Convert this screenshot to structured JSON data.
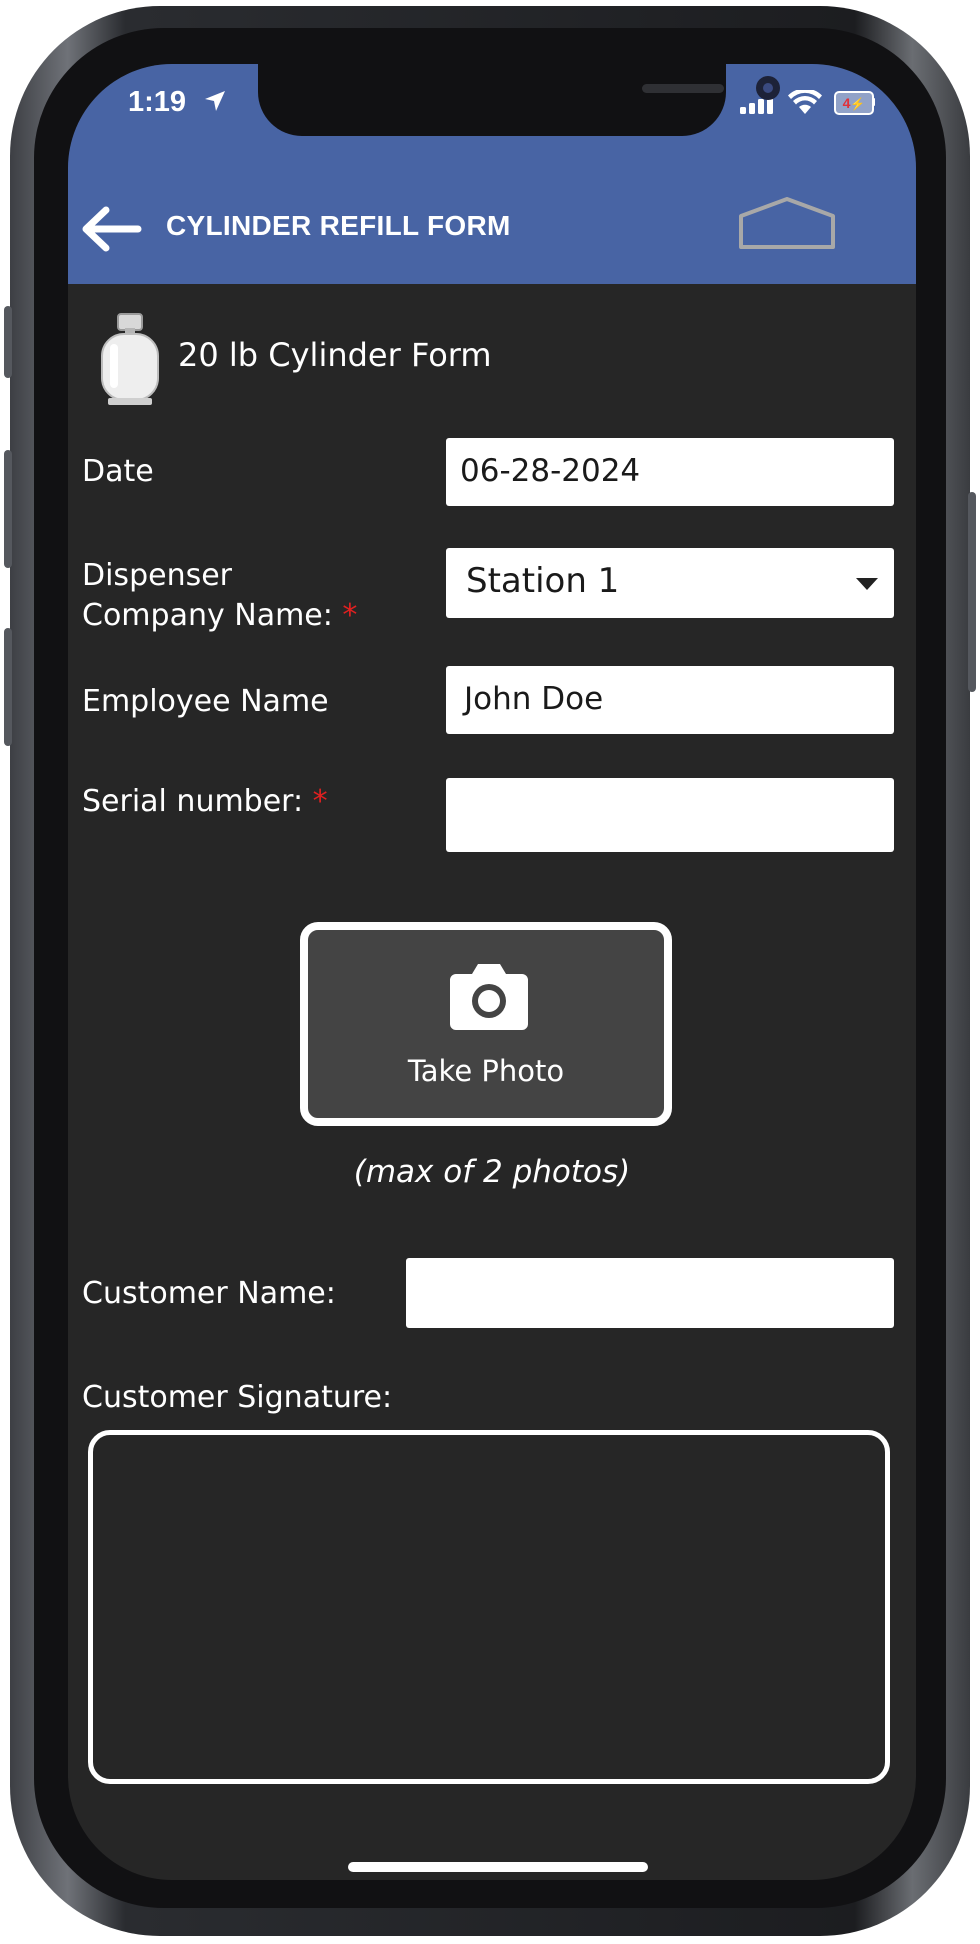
{
  "status_bar": {
    "time": "1:19",
    "battery_level": "4"
  },
  "header": {
    "title": "CYLINDER REFILL FORM",
    "back_icon": "arrow-left-icon",
    "home_icon": "home-icon",
    "bar_color": "#4864a4"
  },
  "form": {
    "title": "20 lb Cylinder Form",
    "fields": {
      "date": {
        "label": "Date",
        "value": "06-28-2024"
      },
      "dispenser_company": {
        "label_line1": "Dispenser",
        "label_line2": "Company Name:",
        "required_marker": "*",
        "value": "Station 1"
      },
      "employee_name": {
        "label": "Employee Name",
        "value": "John Doe"
      },
      "serial_number": {
        "label": "Serial number:",
        "required_marker": "*",
        "value": ""
      },
      "customer_name": {
        "label": "Customer Name:",
        "value": ""
      }
    },
    "photo": {
      "button_label": "Take Photo",
      "note": "(max of 2 photos)",
      "icon": "camera-icon"
    },
    "signature": {
      "label": "Customer Signature:"
    }
  },
  "colors": {
    "background": "#262626",
    "required": "#e02020"
  }
}
